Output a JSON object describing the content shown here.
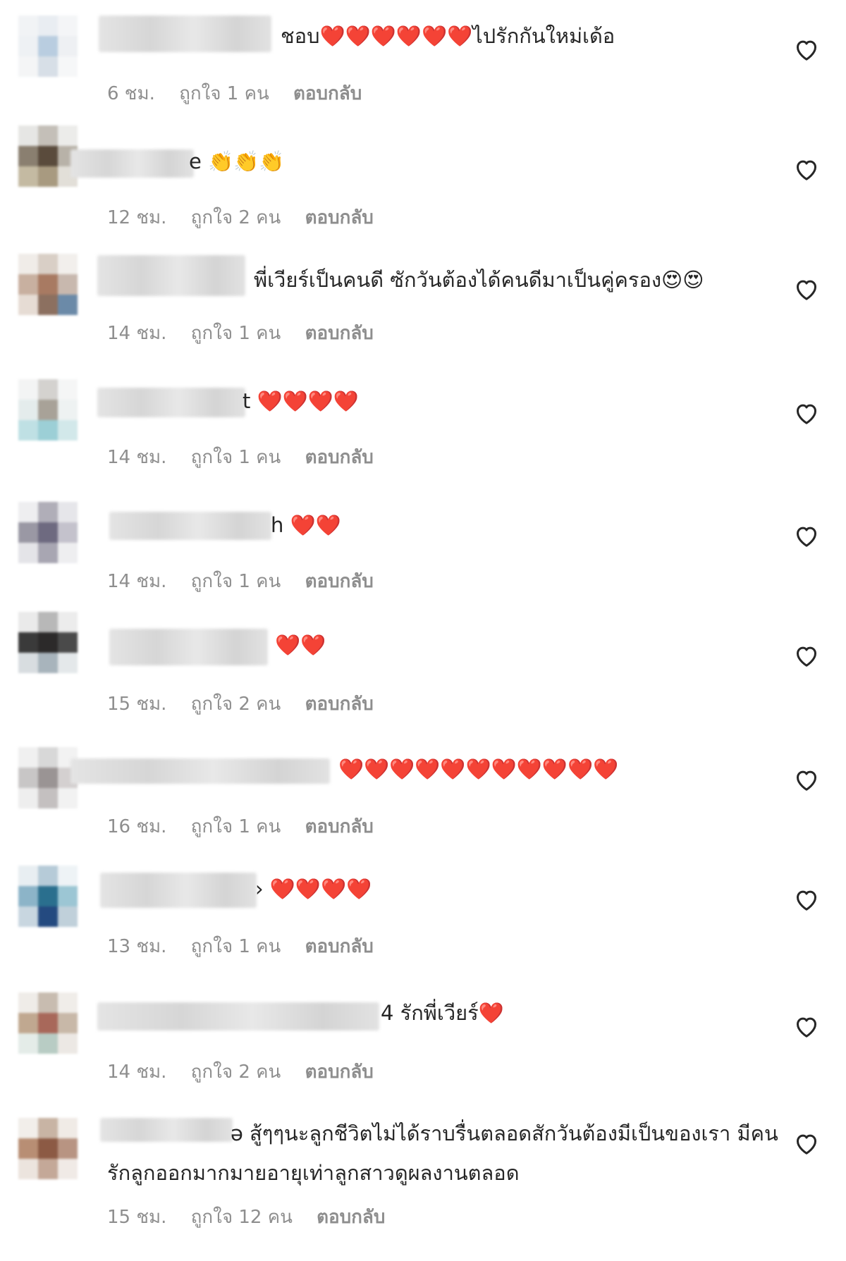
{
  "comments": [
    {
      "text_line1": "ชอบ❤️❤️❤️❤️❤️❤️ไปรักกันใหม่เด้อ",
      "time": "6 ชม.",
      "likes": "ถูกใจ 1 คน",
      "reply": "ตอบกลับ"
    },
    {
      "text_line1": "e 👏👏👏",
      "time": "12 ชม.",
      "likes": "ถูกใจ 2 คน",
      "reply": "ตอบกลับ"
    },
    {
      "text_line1": "พี่เวียร์เป็นคนดี ซักวันต้องได้คนดีมาเป็นคู่ครอง😍😍",
      "time": "14 ชม.",
      "likes": "ถูกใจ 1 คน",
      "reply": "ตอบกลับ"
    },
    {
      "text_line1": "t ❤️❤️❤️❤️",
      "time": "14 ชม.",
      "likes": "ถูกใจ 1 คน",
      "reply": "ตอบกลับ"
    },
    {
      "text_line1": "h ❤️❤️",
      "time": "14 ชม.",
      "likes": "ถูกใจ 1 คน",
      "reply": "ตอบกลับ"
    },
    {
      "text_line1": "❤️❤️",
      "time": "15 ชม.",
      "likes": "ถูกใจ 2 คน",
      "reply": "ตอบกลับ"
    },
    {
      "text_line1": "❤️❤️❤️❤️❤️❤️❤️❤️❤️❤️❤️",
      "time": "16 ชม.",
      "likes": "ถูกใจ 1 คน",
      "reply": "ตอบกลับ"
    },
    {
      "text_line1": "› ❤️❤️❤️❤️",
      "time": "13 ชม.",
      "likes": "ถูกใจ 1 คน",
      "reply": "ตอบกลับ"
    },
    {
      "text_line1": "4 รักพี่เวียร์❤️",
      "time": "14 ชม.",
      "likes": "ถูกใจ 2 คน",
      "reply": "ตอบกลับ"
    },
    {
      "text_line1": "ə สู้ๆๆนะลูกชีวิตไม่ได้ราบรื่นตลอดสักวันต้องมีเป็นของเรา มีคนรักลูกออกมากมายอายุเท่าลูกสาวดูผลงานตลอด",
      "time": "15 ชม.",
      "likes": "ถูกใจ 12 คน",
      "reply": "ตอบกลับ"
    }
  ],
  "icons": {
    "like": "heart-outline-icon"
  },
  "colors": {
    "heart_emoji": "#ed1b24",
    "meta_text": "#8e8e8e",
    "text": "#262626"
  }
}
